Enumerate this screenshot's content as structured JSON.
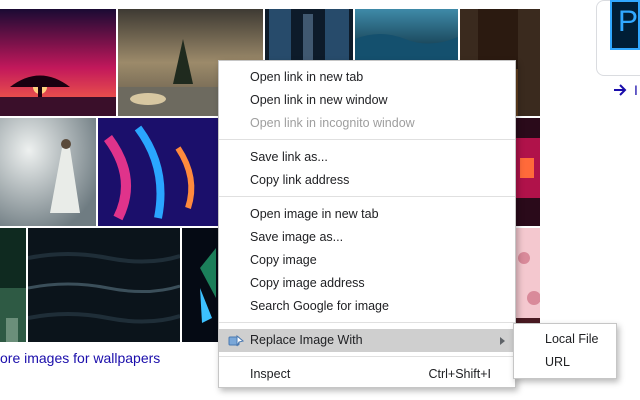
{
  "images": [
    {
      "name": "sunset-tree",
      "colors": [
        "#1a0a33",
        "#c2185b",
        "#ff7043"
      ]
    },
    {
      "name": "lake-tree",
      "colors": [
        "#3e3a33",
        "#9c8a6a",
        "#d7c7a1"
      ]
    },
    {
      "name": "city-street-blue",
      "colors": [
        "#0d1b2a",
        "#274b6b",
        "#8fb3d9"
      ]
    },
    {
      "name": "ocean-waves",
      "colors": [
        "#0b2a3a",
        "#14506e",
        "#3f8aa8"
      ]
    },
    {
      "name": "city-sunset",
      "colors": [
        "#2b1a10",
        "#8a5a2a",
        "#f2b04a"
      ]
    },
    {
      "name": "woman-clouds",
      "colors": [
        "#6f7c82",
        "#c9cfcf",
        "#eef1f0"
      ]
    },
    {
      "name": "abstract-neon",
      "colors": [
        "#1b0f6b",
        "#e0338b",
        "#2aa6ff"
      ]
    },
    {
      "name": "rocks-red",
      "colors": [
        "#2a0a1a",
        "#b0124a",
        "#ff6a3a"
      ]
    },
    {
      "name": "forest-road",
      "colors": [
        "#0f2a20",
        "#2e5a44",
        "#6b8f7a"
      ]
    },
    {
      "name": "dark-water",
      "colors": [
        "#0b141b",
        "#1f2e38",
        "#3b4f5a"
      ]
    },
    {
      "name": "butterfly",
      "colors": [
        "#050a14",
        "#1b7f5a",
        "#3cc0ff"
      ]
    },
    {
      "name": "pink-blossoms",
      "colors": [
        "#4a1a22",
        "#d98a9a",
        "#f4c8cf"
      ]
    }
  ],
  "more_images_text": "ore images for wallpapers",
  "side_panel": {
    "app_icon_text": "Ps",
    "arrow_text": "I"
  },
  "context_menu": {
    "items": [
      {
        "label": "Open link in new tab"
      },
      {
        "label": "Open link in new window"
      },
      {
        "label": "Open link in incognito window",
        "disabled": true
      },
      {
        "label": "Save link as..."
      },
      {
        "label": "Copy link address"
      },
      {
        "label": "Open image in new tab"
      },
      {
        "label": "Save image as..."
      },
      {
        "label": "Copy image"
      },
      {
        "label": "Copy image address"
      },
      {
        "label": "Search Google for image"
      },
      {
        "label": "Replace Image With",
        "icon": "replace-image-icon",
        "has_submenu": true
      },
      {
        "label": "Inspect",
        "accelerator": "Ctrl+Shift+I"
      }
    ]
  },
  "submenu": {
    "items": [
      {
        "label": "Local File"
      },
      {
        "label": "URL"
      }
    ]
  }
}
